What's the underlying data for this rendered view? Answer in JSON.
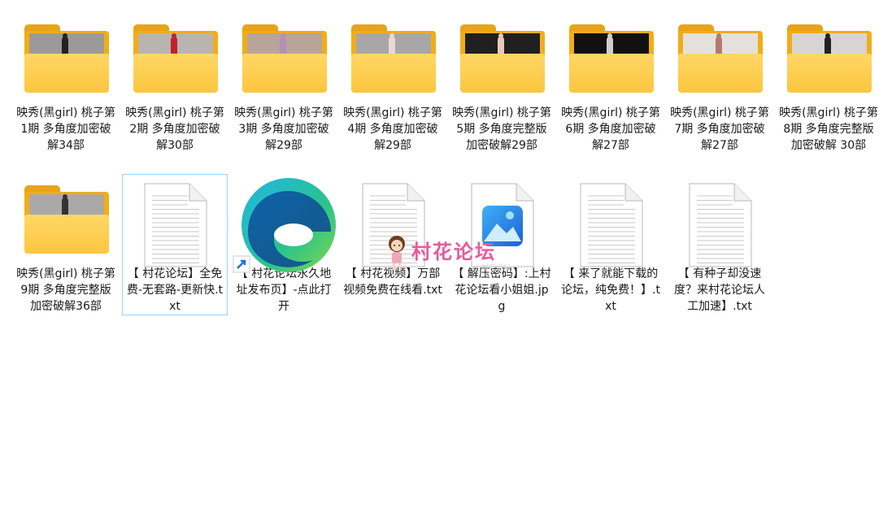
{
  "files": [
    {
      "label": "映秀(黑girl) 桃子第1期 多角度加密破解34部",
      "kind": "folder",
      "photo": "#9a9a9a",
      "figure": "#222"
    },
    {
      "label": "映秀(黑girl) 桃子第2期 多角度加密破解30部",
      "kind": "folder",
      "photo": "#b9b4b0",
      "figure": "#c4202a"
    },
    {
      "label": "映秀(黑girl) 桃子第3期 多角度加密破解29部",
      "kind": "folder",
      "photo": "#b9a49a",
      "figure": "#b78fb5"
    },
    {
      "label": "映秀(黑girl) 桃子第4期 多角度加密破解29部",
      "kind": "folder",
      "photo": "#a7a7a7",
      "figure": "#e9d9cf"
    },
    {
      "label": "映秀(黑girl) 桃子第5期 多角度完整版加密破解29部",
      "kind": "folder",
      "photo": "#202020",
      "figure": "#e9c8b8"
    },
    {
      "label": "映秀(黑girl) 桃子第6期 多角度加密破解27部",
      "kind": "folder",
      "photo": "#111111",
      "figure": "#cfcfcf"
    },
    {
      "label": "映秀(黑girl) 桃子第7期 多角度加密破解27部",
      "kind": "folder",
      "photo": "#e4e1dd",
      "figure": "#b47a6c"
    },
    {
      "label": "映秀(黑girl) 桃子第8期 多角度完整版加密破解 30部",
      "kind": "folder",
      "photo": "#d7d5d3",
      "figure": "#222"
    },
    {
      "label": "映秀(黑girl) 桃子第9期 多角度完整版加密破解36部",
      "kind": "folder",
      "photo": "#aaa9a7",
      "figure": "#333"
    },
    {
      "label": "【 村花论坛】全免费-无套路-更新快.txt",
      "kind": "txt",
      "selected": true
    },
    {
      "label": "【 村花论坛永久地址发布页】-点此打开",
      "kind": "edge"
    },
    {
      "label": "【 村花视频】万部视频免费在线看.txt",
      "kind": "txt"
    },
    {
      "label": "【 解压密码】:上村花论坛看小姐姐.jpg",
      "kind": "jpg"
    },
    {
      "label": "【 来了就能下载的论坛，纯免费！】.txt",
      "kind": "txt"
    },
    {
      "label": "【 有种子却没速度？来村花论坛人工加速】.txt",
      "kind": "txt"
    }
  ],
  "watermark": {
    "text": "村花论坛",
    "small": "村花论坛"
  },
  "colors": {
    "selection": "#99d1ff",
    "folder_back": "#f1ad18",
    "folder_front": "#fcc63f",
    "watermark": "#e85a9b"
  }
}
